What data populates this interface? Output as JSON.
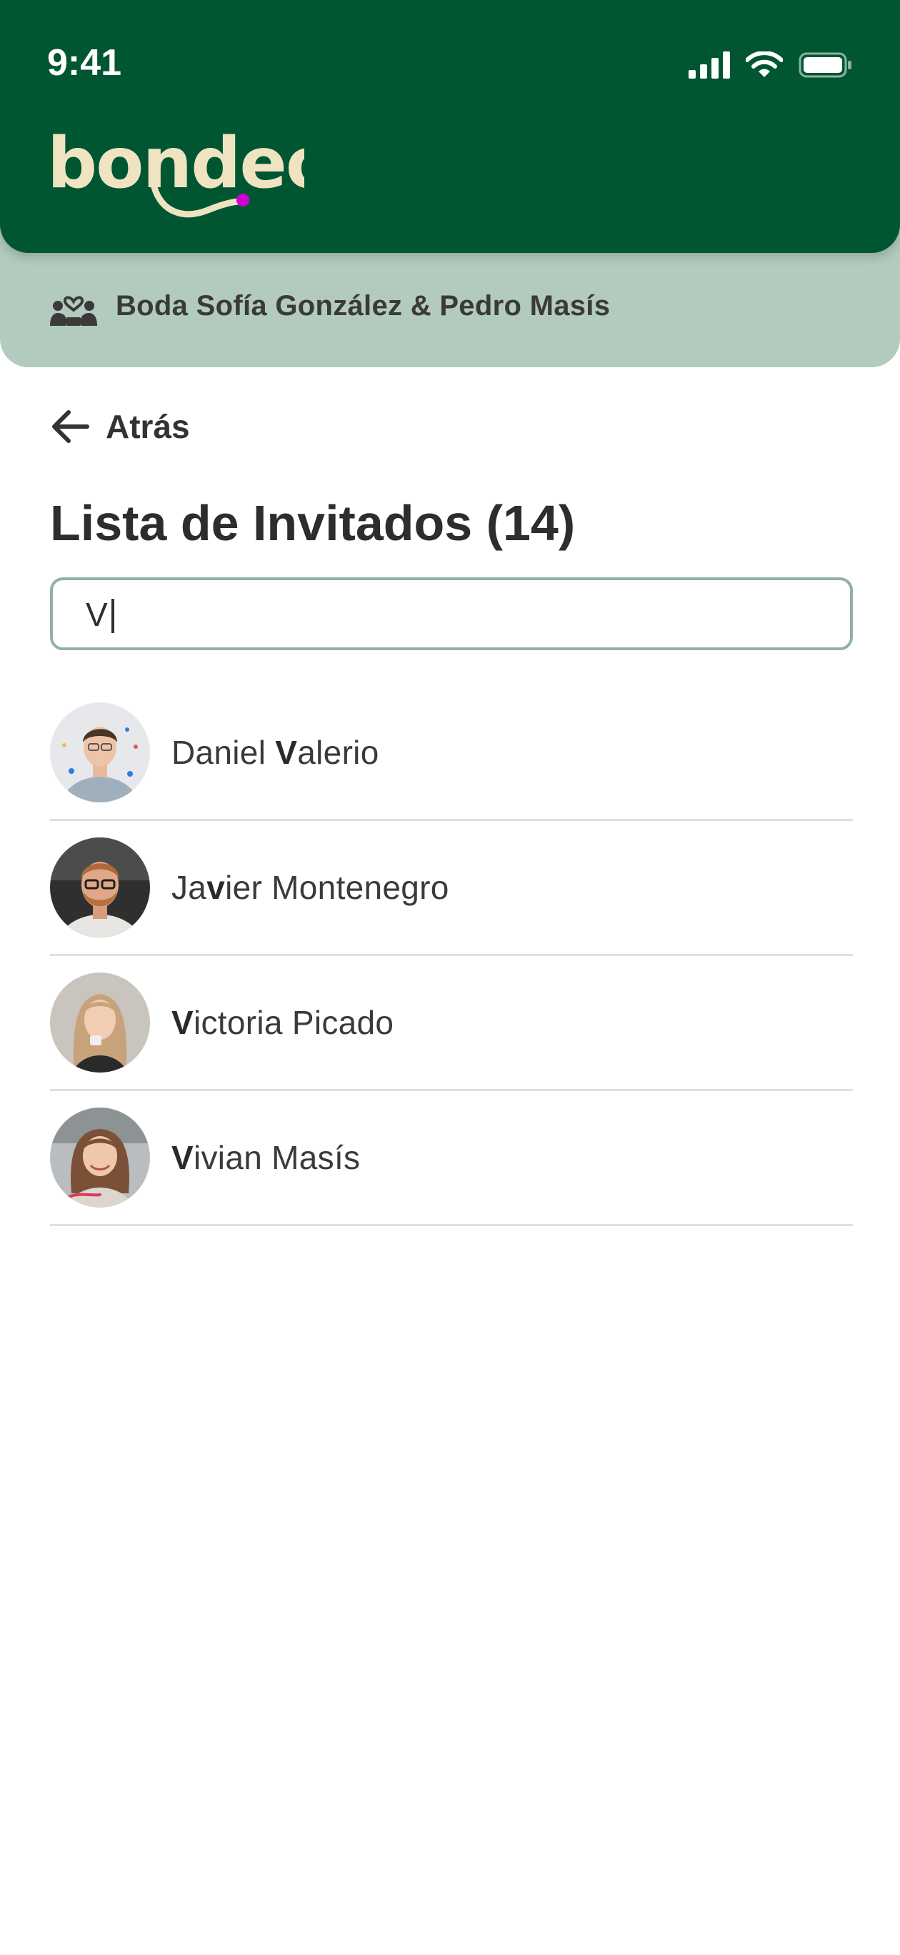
{
  "status_bar": {
    "time": "9:41"
  },
  "brand": {
    "logo_text": "bondeo",
    "primary_color": "#005631",
    "accent_dot_color": "#d100d1",
    "logo_color": "#efe3c2"
  },
  "event": {
    "title": "Boda Sofía González & Pedro Masís",
    "icon": "couple-heart-icon"
  },
  "nav": {
    "back_label": "Atrás",
    "back_icon": "arrow-left-icon"
  },
  "page": {
    "title": "Lista de Invitados (14)"
  },
  "search": {
    "value": "V",
    "placeholder": ""
  },
  "guests": [
    {
      "pre": "Daniel ",
      "match": "V",
      "post": "alerio"
    },
    {
      "pre": "Ja",
      "match": "v",
      "post": "ier Montenegro"
    },
    {
      "pre": "",
      "match": "V",
      "post": "ictoria Picado"
    },
    {
      "pre": "",
      "match": "V",
      "post": "ivian Masís"
    }
  ]
}
